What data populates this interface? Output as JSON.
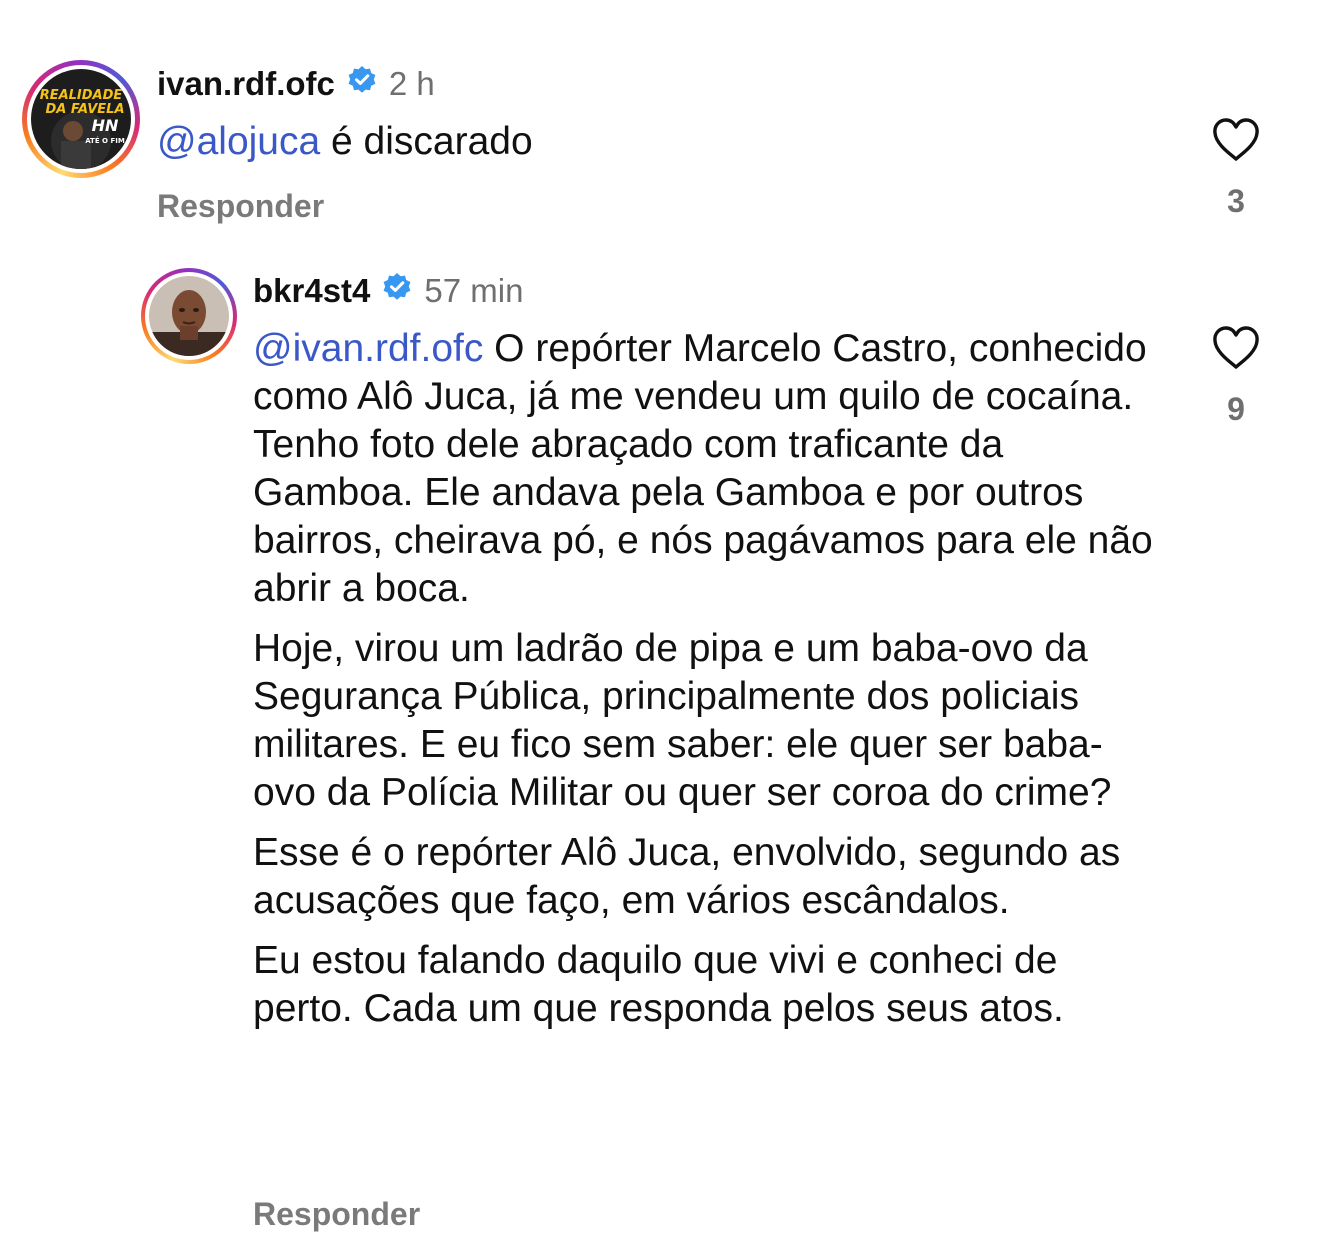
{
  "comments": [
    {
      "username": "ivan.rdf.ofc",
      "time": "2 h",
      "mention": "@alojuca",
      "text": " é discarado",
      "reply_label": "Responder",
      "likes": "3",
      "avatar": {
        "line1": "REALIDADE",
        "line2": "DA FAVELA",
        "line3": "HN",
        "line4": "ATÉ O FIM"
      }
    },
    {
      "username": "bkr4st4",
      "time": "57 min",
      "mention": "@ivan.rdf.ofc",
      "paragraphs": [
        " O repórter Marcelo Castro, conhecido como Alô Juca, já me vendeu um quilo de cocaína. Tenho foto dele abraçado com traficante da Gamboa. Ele andava pela Gamboa e por outros bairros, cheirava pó, e nós pagávamos para ele não abrir a boca.",
        "Hoje, virou um ladrão de pipa e um baba-ovo da Segurança Pública, principalmente dos policiais militares. E eu fico sem saber: ele quer ser baba-ovo da Polícia Militar ou quer ser coroa do crime?",
        "Esse é o repórter Alô Juca, envolvido, segundo as acusações que faço, em vários escândalos.",
        "Eu estou falando daquilo que vivi e conheci de perto. Cada um que responda pelos seus atos."
      ],
      "reply_label": "Responder",
      "likes": "9"
    }
  ],
  "colors": {
    "mention": "#3b58c7",
    "verified": "#3897f0",
    "secondary_text": "#7a7a7a"
  },
  "icons": {
    "verified": "verified-badge-icon",
    "like": "heart-outline-icon"
  }
}
